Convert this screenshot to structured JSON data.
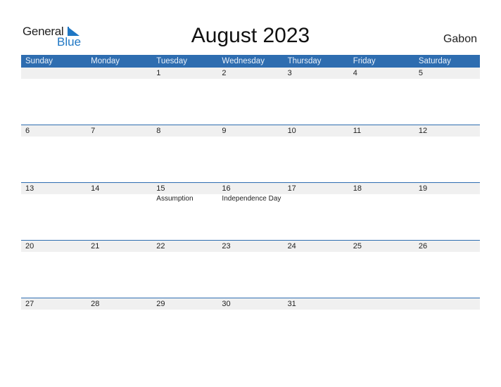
{
  "logo": {
    "general": "General",
    "blue": "Blue"
  },
  "title": "August 2023",
  "country": "Gabon",
  "colors": {
    "accent": "#2e6db0",
    "row_bg": "#f0f0f0"
  },
  "weekdays": [
    "Sunday",
    "Monday",
    "Tuesday",
    "Wednesday",
    "Thursday",
    "Friday",
    "Saturday"
  ],
  "weeks": [
    {
      "days": [
        "",
        "",
        "1",
        "2",
        "3",
        "4",
        "5"
      ],
      "events": [
        "",
        "",
        "",
        "",
        "",
        "",
        ""
      ]
    },
    {
      "days": [
        "6",
        "7",
        "8",
        "9",
        "10",
        "11",
        "12"
      ],
      "events": [
        "",
        "",
        "",
        "",
        "",
        "",
        ""
      ]
    },
    {
      "days": [
        "13",
        "14",
        "15",
        "16",
        "17",
        "18",
        "19"
      ],
      "events": [
        "",
        "",
        "Assumption",
        "Independence Day",
        "",
        "",
        ""
      ]
    },
    {
      "days": [
        "20",
        "21",
        "22",
        "23",
        "24",
        "25",
        "26"
      ],
      "events": [
        "",
        "",
        "",
        "",
        "",
        "",
        ""
      ]
    },
    {
      "days": [
        "27",
        "28",
        "29",
        "30",
        "31",
        "",
        ""
      ],
      "events": [
        "",
        "",
        "",
        "",
        "",
        "",
        ""
      ]
    }
  ]
}
